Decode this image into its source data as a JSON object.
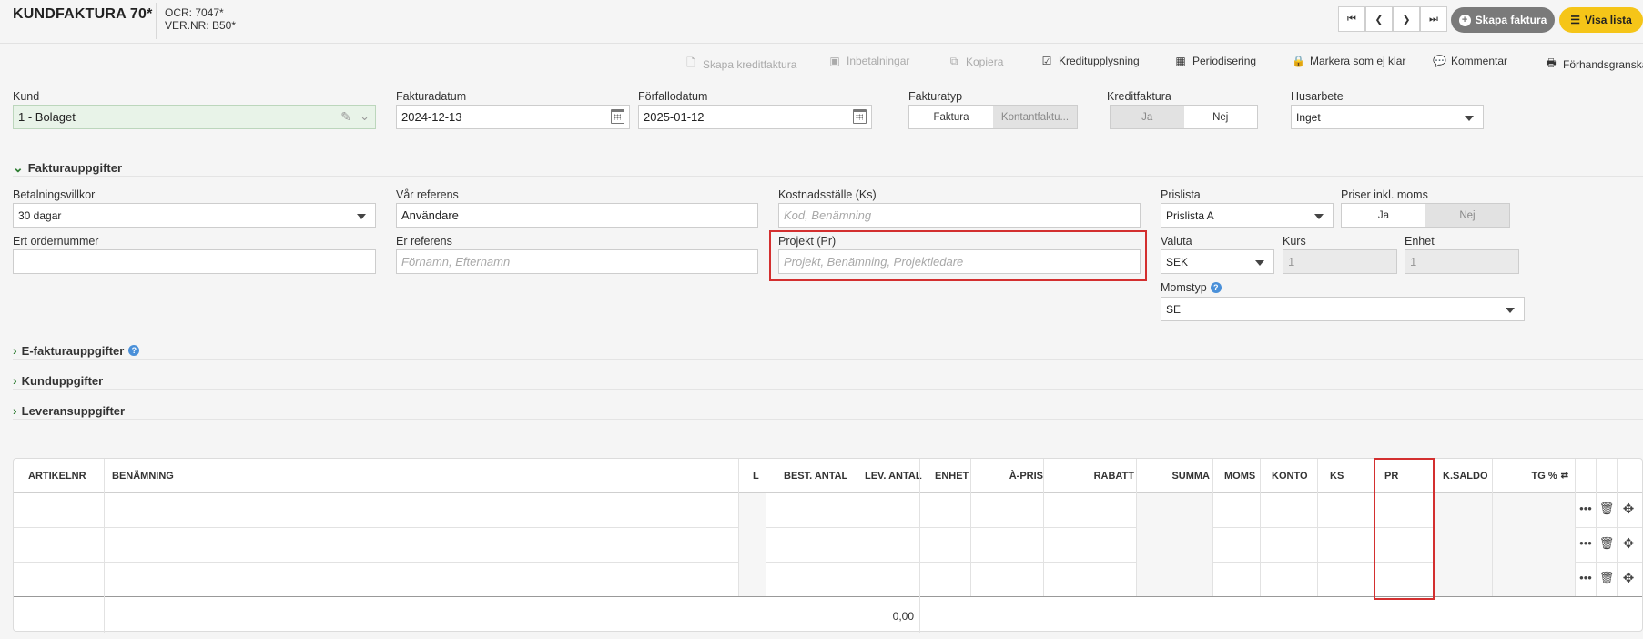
{
  "header": {
    "title": "KUNDFAKTURA 70*",
    "ocr": "OCR: 7047*",
    "ver_nr": "VER.NR: B50*",
    "create_invoice": "Skapa faktura",
    "show_list": "Visa lista"
  },
  "toolbar": {
    "create_credit": "Skapa kreditfaktura",
    "payments": "Inbetalningar",
    "copy": "Kopiera",
    "credit_report": "Kreditupplysning",
    "accrual": "Periodisering",
    "mark_unfinished": "Markera som ej klar",
    "comment": "Kommentar",
    "preview": "Förhandsgranska"
  },
  "form": {
    "customer_label": "Kund",
    "customer_value": "1 - Bolaget",
    "invoice_date_label": "Fakturadatum",
    "invoice_date": "2024-12-13",
    "due_date_label": "Förfallodatum",
    "due_date": "2025-01-12",
    "invoice_type_label": "Fakturatyp",
    "invoice_type_options": [
      "Faktura",
      "Kontantfaktu..."
    ],
    "credit_invoice_label": "Kreditfaktura",
    "credit_invoice_options": [
      "Ja",
      "Nej"
    ],
    "house_work_label": "Husarbete",
    "house_work_value": "Inget"
  },
  "invoice_details": {
    "section_title": "Fakturauppgifter",
    "payment_terms_label": "Betalningsvillkor",
    "payment_terms_value": "30 dagar",
    "our_reference_label": "Vår referens",
    "our_reference_value": "Användare",
    "cost_center_label": "Kostnadsställe (Ks)",
    "cost_center_placeholder": "Kod, Benämning",
    "price_list_label": "Prislista",
    "price_list_value": "Prislista A",
    "prices_incl_vat_label": "Priser inkl. moms",
    "prices_incl_vat_options": [
      "Ja",
      "Nej"
    ],
    "your_order_label": "Ert ordernummer",
    "your_reference_label": "Er referens",
    "your_reference_placeholder": "Förnamn, Efternamn",
    "project_label": "Projekt (Pr)",
    "project_placeholder": "Projekt, Benämning, Projektledare",
    "currency_label": "Valuta",
    "currency_value": "SEK",
    "rate_label": "Kurs",
    "rate_value": "1",
    "unit_label": "Enhet",
    "unit_value": "1",
    "vat_type_label": "Momstyp",
    "vat_type_value": "SE"
  },
  "sections": {
    "e_invoice": "E-fakturauppgifter",
    "customer": "Kunduppgifter",
    "delivery": "Leveransuppgifter"
  },
  "table": {
    "columns": [
      "ARTIKELNR",
      "BENÄMNING",
      "L",
      "BEST. ANTAL",
      "LEV. ANTAL",
      "ENHET",
      "À-PRIS",
      "RABATT",
      "SUMMA",
      "MOMS",
      "KONTO",
      "KS",
      "PR",
      "K.SALDO",
      "TG %"
    ],
    "total": "0,00",
    "row_count": 3
  },
  "colors": {
    "accent_yellow": "#f5c518",
    "gray_button": "#7a7a7a",
    "highlight_red": "#d32f2f",
    "customer_bg": "#e8f3e8"
  }
}
